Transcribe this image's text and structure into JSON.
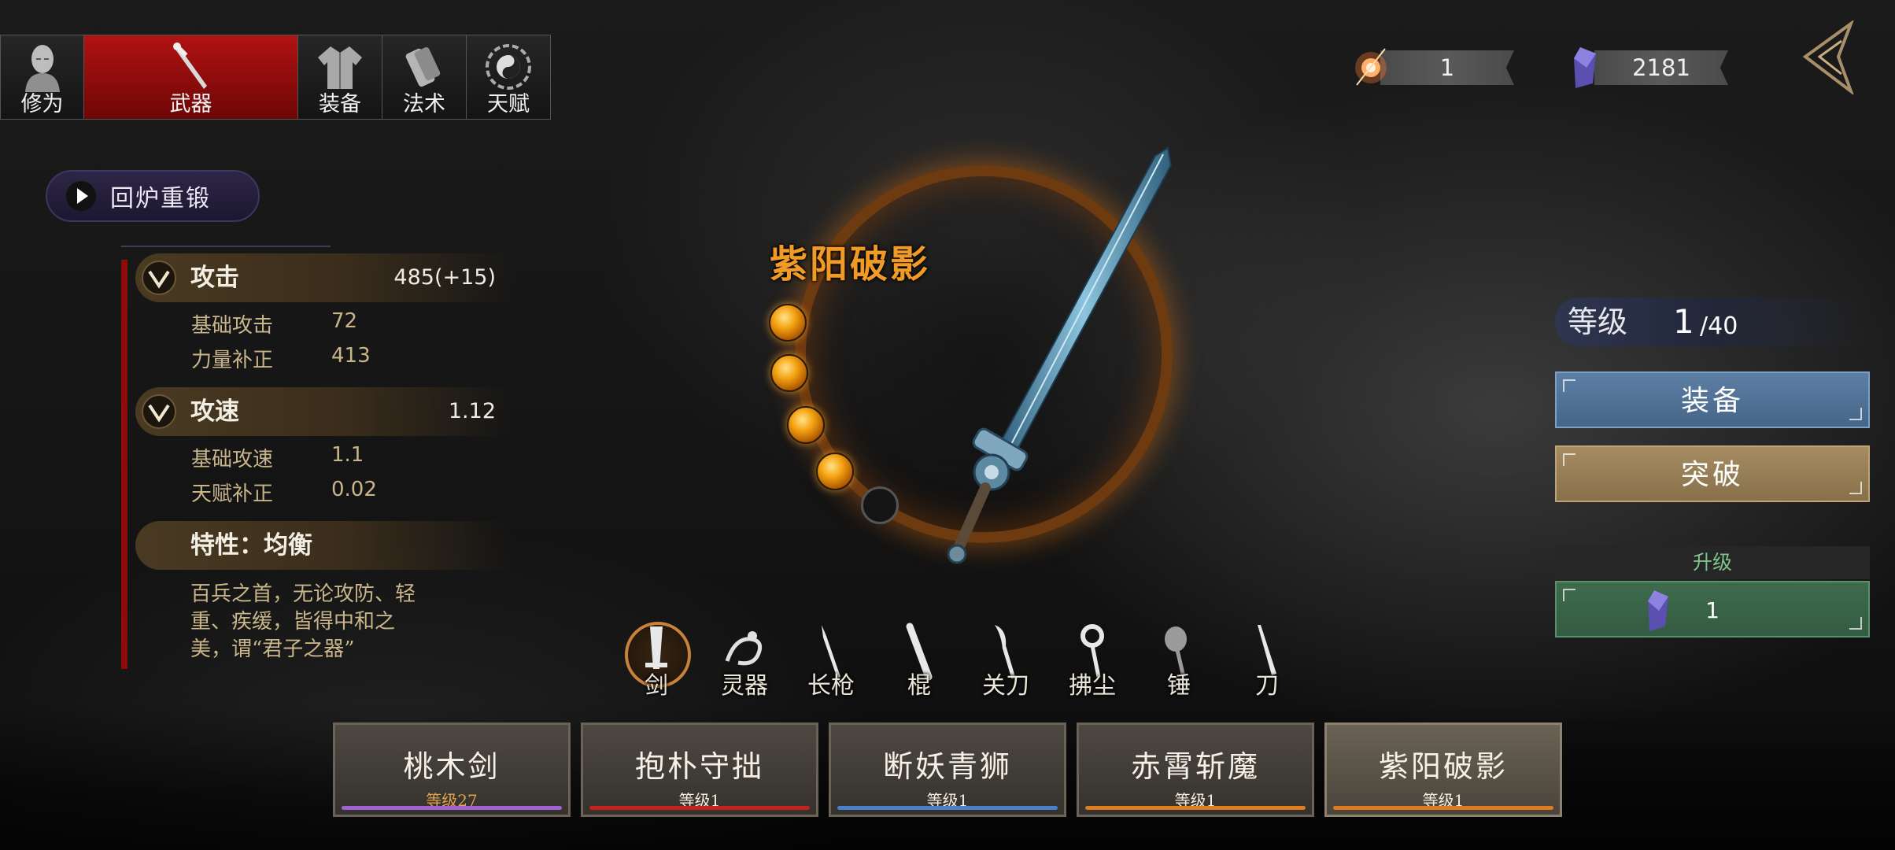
{
  "tabs": [
    {
      "label": "修为",
      "icon": "meditation-figure-icon",
      "active": false
    },
    {
      "label": "武器",
      "icon": "sword-icon",
      "active": true
    },
    {
      "label": "装备",
      "icon": "robe-icon",
      "active": false
    },
    {
      "label": "法术",
      "icon": "scroll-icon",
      "active": false
    },
    {
      "label": "天赋",
      "icon": "taiji-bagua-icon",
      "active": false
    }
  ],
  "currency": {
    "fire_orb": {
      "value": "1",
      "icon": "fire-orb-icon"
    },
    "crystal": {
      "value": "2181",
      "icon": "purple-crystal-icon"
    }
  },
  "recast": {
    "label": "回炉重锻"
  },
  "stats": {
    "attack": {
      "name": "攻击",
      "value": "485(+15)",
      "subs": [
        {
          "label": "基础攻击",
          "value": "72"
        },
        {
          "label": "力量补正",
          "value": "413"
        }
      ]
    },
    "speed": {
      "name": "攻速",
      "value": "1.12",
      "subs": [
        {
          "label": "基础攻速",
          "value": "1.1"
        },
        {
          "label": "天赋补正",
          "value": "0.02"
        }
      ]
    },
    "trait": {
      "name": "特性：均衡",
      "desc": "百兵之首，无论攻防、轻重、疾缓，皆得中和之美，谓“君子之器”"
    }
  },
  "weapon": {
    "name": "紫阳破影",
    "orbs_filled": 4,
    "orbs_total": 5
  },
  "weapon_types": [
    {
      "label": "剑",
      "icon": "sword-type-icon",
      "active": true
    },
    {
      "label": "灵器",
      "icon": "dragon-spirit-icon",
      "active": false
    },
    {
      "label": "长枪",
      "icon": "spear-icon",
      "active": false
    },
    {
      "label": "棍",
      "icon": "staff-icon",
      "active": false
    },
    {
      "label": "关刀",
      "icon": "guandao-icon",
      "active": false
    },
    {
      "label": "拂尘",
      "icon": "whisk-icon",
      "active": false
    },
    {
      "label": "锤",
      "icon": "hammer-icon",
      "active": false
    },
    {
      "label": "刀",
      "icon": "saber-icon",
      "active": false
    }
  ],
  "right_panel": {
    "level_label": "等级",
    "level_current": "1",
    "level_max": "/40",
    "equip_label": "装备",
    "breakthrough_label": "突破",
    "upgrade_label": "升级",
    "upgrade_cost": "1"
  },
  "weapons": [
    {
      "name": "桃木剑",
      "level": "等级27",
      "stripe": "#a262d6",
      "level_color": "#e0a24a",
      "selected": false
    },
    {
      "name": "抱朴守拙",
      "level": "等级1",
      "stripe": "#c8201c",
      "level_color": "#f2ede0",
      "selected": false
    },
    {
      "name": "断妖青狮",
      "level": "等级1",
      "stripe": "#4a7fd0",
      "level_color": "#f2ede0",
      "selected": false
    },
    {
      "name": "赤霄斩魔",
      "level": "等级1",
      "stripe": "#e07a1e",
      "level_color": "#f2ede0",
      "selected": false
    },
    {
      "name": "紫阳破影",
      "level": "等级1",
      "stripe": "#e07a1e",
      "level_color": "#f2ede0",
      "selected": true
    }
  ]
}
